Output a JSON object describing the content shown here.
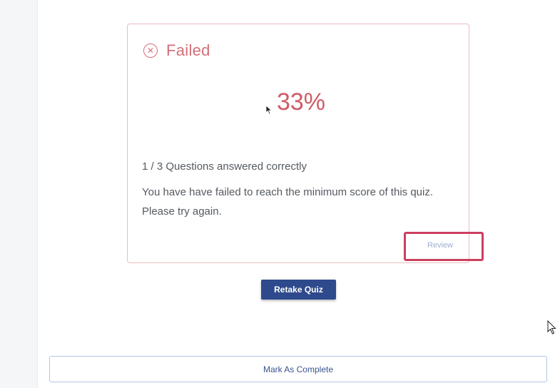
{
  "quiz_result": {
    "status": "Failed",
    "status_icon": "close-circle-icon",
    "score": "33%",
    "correct_summary": "1 / 3 Questions answered correctly",
    "message": "You have have failed to reach the minimum score of this quiz. Please try again.",
    "review_label": "Review"
  },
  "actions": {
    "retake_label": "Retake Quiz",
    "complete_label": "Mark As Complete"
  },
  "colors": {
    "fail_red": "#d46f78",
    "primary_blue": "#2f4a8c",
    "highlight": "#cc3f5e"
  }
}
